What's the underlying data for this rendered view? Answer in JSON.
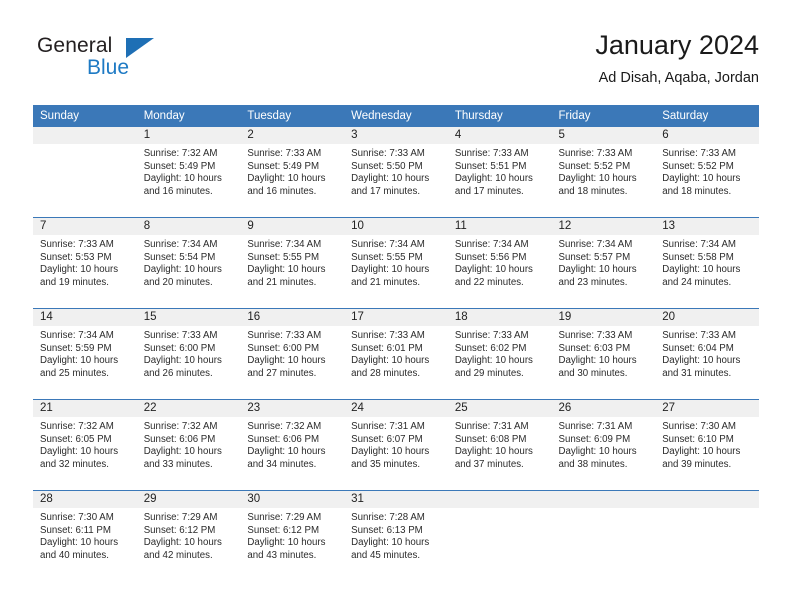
{
  "brand": {
    "name_top": "General",
    "name_bottom": "Blue",
    "triangle_color": "#1e6fb5",
    "blue_color": "#1e7ac4"
  },
  "header": {
    "month_title": "January 2024",
    "location": "Ad Disah, Aqaba, Jordan"
  },
  "theme": {
    "header_blue": "#3b78b8",
    "daynum_band": "#f0f0f0",
    "row_divider": "#3b78b8"
  },
  "weekdays": [
    "Sunday",
    "Monday",
    "Tuesday",
    "Wednesday",
    "Thursday",
    "Friday",
    "Saturday"
  ],
  "labels": {
    "sunrise_prefix": "Sunrise:",
    "sunset_prefix": "Sunset:",
    "daylight_prefix": "Daylight:"
  },
  "weeks": [
    [
      {
        "day": "",
        "blank": true,
        "line1": "",
        "line2": "",
        "line3": "",
        "line4": ""
      },
      {
        "day": "1",
        "line1": "Sunrise: 7:32 AM",
        "line2": "Sunset: 5:49 PM",
        "line3": "Daylight: 10 hours",
        "line4": "and 16 minutes."
      },
      {
        "day": "2",
        "line1": "Sunrise: 7:33 AM",
        "line2": "Sunset: 5:49 PM",
        "line3": "Daylight: 10 hours",
        "line4": "and 16 minutes."
      },
      {
        "day": "3",
        "line1": "Sunrise: 7:33 AM",
        "line2": "Sunset: 5:50 PM",
        "line3": "Daylight: 10 hours",
        "line4": "and 17 minutes."
      },
      {
        "day": "4",
        "line1": "Sunrise: 7:33 AM",
        "line2": "Sunset: 5:51 PM",
        "line3": "Daylight: 10 hours",
        "line4": "and 17 minutes."
      },
      {
        "day": "5",
        "line1": "Sunrise: 7:33 AM",
        "line2": "Sunset: 5:52 PM",
        "line3": "Daylight: 10 hours",
        "line4": "and 18 minutes."
      },
      {
        "day": "6",
        "line1": "Sunrise: 7:33 AM",
        "line2": "Sunset: 5:52 PM",
        "line3": "Daylight: 10 hours",
        "line4": "and 18 minutes."
      }
    ],
    [
      {
        "day": "7",
        "line1": "Sunrise: 7:33 AM",
        "line2": "Sunset: 5:53 PM",
        "line3": "Daylight: 10 hours",
        "line4": "and 19 minutes."
      },
      {
        "day": "8",
        "line1": "Sunrise: 7:34 AM",
        "line2": "Sunset: 5:54 PM",
        "line3": "Daylight: 10 hours",
        "line4": "and 20 minutes."
      },
      {
        "day": "9",
        "line1": "Sunrise: 7:34 AM",
        "line2": "Sunset: 5:55 PM",
        "line3": "Daylight: 10 hours",
        "line4": "and 21 minutes."
      },
      {
        "day": "10",
        "line1": "Sunrise: 7:34 AM",
        "line2": "Sunset: 5:55 PM",
        "line3": "Daylight: 10 hours",
        "line4": "and 21 minutes."
      },
      {
        "day": "11",
        "line1": "Sunrise: 7:34 AM",
        "line2": "Sunset: 5:56 PM",
        "line3": "Daylight: 10 hours",
        "line4": "and 22 minutes."
      },
      {
        "day": "12",
        "line1": "Sunrise: 7:34 AM",
        "line2": "Sunset: 5:57 PM",
        "line3": "Daylight: 10 hours",
        "line4": "and 23 minutes."
      },
      {
        "day": "13",
        "line1": "Sunrise: 7:34 AM",
        "line2": "Sunset: 5:58 PM",
        "line3": "Daylight: 10 hours",
        "line4": "and 24 minutes."
      }
    ],
    [
      {
        "day": "14",
        "line1": "Sunrise: 7:34 AM",
        "line2": "Sunset: 5:59 PM",
        "line3": "Daylight: 10 hours",
        "line4": "and 25 minutes."
      },
      {
        "day": "15",
        "line1": "Sunrise: 7:33 AM",
        "line2": "Sunset: 6:00 PM",
        "line3": "Daylight: 10 hours",
        "line4": "and 26 minutes."
      },
      {
        "day": "16",
        "line1": "Sunrise: 7:33 AM",
        "line2": "Sunset: 6:00 PM",
        "line3": "Daylight: 10 hours",
        "line4": "and 27 minutes."
      },
      {
        "day": "17",
        "line1": "Sunrise: 7:33 AM",
        "line2": "Sunset: 6:01 PM",
        "line3": "Daylight: 10 hours",
        "line4": "and 28 minutes."
      },
      {
        "day": "18",
        "line1": "Sunrise: 7:33 AM",
        "line2": "Sunset: 6:02 PM",
        "line3": "Daylight: 10 hours",
        "line4": "and 29 minutes."
      },
      {
        "day": "19",
        "line1": "Sunrise: 7:33 AM",
        "line2": "Sunset: 6:03 PM",
        "line3": "Daylight: 10 hours",
        "line4": "and 30 minutes."
      },
      {
        "day": "20",
        "line1": "Sunrise: 7:33 AM",
        "line2": "Sunset: 6:04 PM",
        "line3": "Daylight: 10 hours",
        "line4": "and 31 minutes."
      }
    ],
    [
      {
        "day": "21",
        "line1": "Sunrise: 7:32 AM",
        "line2": "Sunset: 6:05 PM",
        "line3": "Daylight: 10 hours",
        "line4": "and 32 minutes."
      },
      {
        "day": "22",
        "line1": "Sunrise: 7:32 AM",
        "line2": "Sunset: 6:06 PM",
        "line3": "Daylight: 10 hours",
        "line4": "and 33 minutes."
      },
      {
        "day": "23",
        "line1": "Sunrise: 7:32 AM",
        "line2": "Sunset: 6:06 PM",
        "line3": "Daylight: 10 hours",
        "line4": "and 34 minutes."
      },
      {
        "day": "24",
        "line1": "Sunrise: 7:31 AM",
        "line2": "Sunset: 6:07 PM",
        "line3": "Daylight: 10 hours",
        "line4": "and 35 minutes."
      },
      {
        "day": "25",
        "line1": "Sunrise: 7:31 AM",
        "line2": "Sunset: 6:08 PM",
        "line3": "Daylight: 10 hours",
        "line4": "and 37 minutes."
      },
      {
        "day": "26",
        "line1": "Sunrise: 7:31 AM",
        "line2": "Sunset: 6:09 PM",
        "line3": "Daylight: 10 hours",
        "line4": "and 38 minutes."
      },
      {
        "day": "27",
        "line1": "Sunrise: 7:30 AM",
        "line2": "Sunset: 6:10 PM",
        "line3": "Daylight: 10 hours",
        "line4": "and 39 minutes."
      }
    ],
    [
      {
        "day": "28",
        "line1": "Sunrise: 7:30 AM",
        "line2": "Sunset: 6:11 PM",
        "line3": "Daylight: 10 hours",
        "line4": "and 40 minutes."
      },
      {
        "day": "29",
        "line1": "Sunrise: 7:29 AM",
        "line2": "Sunset: 6:12 PM",
        "line3": "Daylight: 10 hours",
        "line4": "and 42 minutes."
      },
      {
        "day": "30",
        "line1": "Sunrise: 7:29 AM",
        "line2": "Sunset: 6:12 PM",
        "line3": "Daylight: 10 hours",
        "line4": "and 43 minutes."
      },
      {
        "day": "31",
        "line1": "Sunrise: 7:28 AM",
        "line2": "Sunset: 6:13 PM",
        "line3": "Daylight: 10 hours",
        "line4": "and 45 minutes."
      },
      {
        "day": "",
        "blank": true,
        "line1": "",
        "line2": "",
        "line3": "",
        "line4": ""
      },
      {
        "day": "",
        "blank": true,
        "line1": "",
        "line2": "",
        "line3": "",
        "line4": ""
      },
      {
        "day": "",
        "blank": true,
        "line1": "",
        "line2": "",
        "line3": "",
        "line4": ""
      }
    ]
  ]
}
